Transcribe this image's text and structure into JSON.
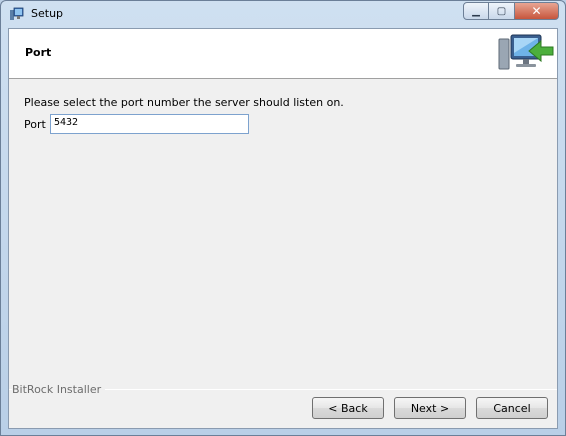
{
  "window": {
    "title": "Setup",
    "icons": {
      "app": "setup-app-icon",
      "minimize": "minimize-icon",
      "maximize": "maximize-icon",
      "close": "close-icon"
    }
  },
  "header": {
    "title": "Port",
    "icon": "computer-arrow-icon"
  },
  "main": {
    "instruction": "Please select the port number the server should listen on.",
    "port_label": "Port",
    "port_value": "5432"
  },
  "footer": {
    "installer_label": "BitRock Installer",
    "back_label": "< Back",
    "next_label": "Next >",
    "cancel_label": "Cancel"
  }
}
